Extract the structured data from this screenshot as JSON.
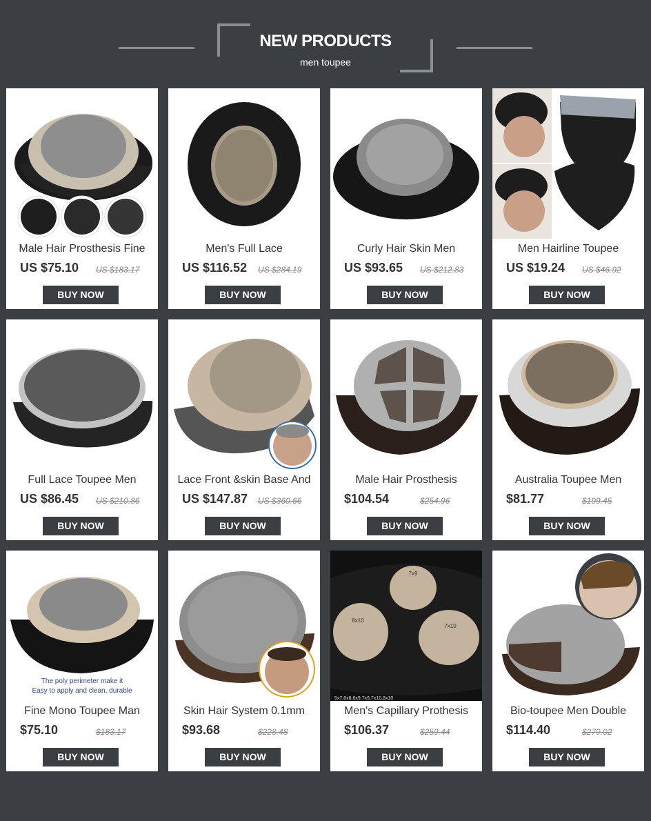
{
  "header": {
    "title": "NEW PRODUCTS",
    "subtitle": "men toupee"
  },
  "colors": {
    "background": "#3b3e42",
    "card": "#ffffff",
    "button": "#3b3e42",
    "button_text": "#ffffff"
  },
  "products": [
    {
      "name": "Male Hair Prosthesis Fine",
      "price": "US $75.10",
      "old_price": "US $183.17",
      "button": "BUY NOW"
    },
    {
      "name": "Men's Full Lace",
      "price": "US $116.52",
      "old_price": "US $284.19",
      "button": "BUY NOW"
    },
    {
      "name": "Curly Hair Skin Men",
      "price": "US $93.65",
      "old_price": "US $212.83",
      "button": "BUY NOW"
    },
    {
      "name": "Men Hairline Toupee",
      "price": "US $19.24",
      "old_price": "US $46.92",
      "button": "BUY NOW"
    },
    {
      "name": "Full Lace Toupee Men",
      "price": "US $86.45",
      "old_price": "US $210.86",
      "button": "BUY NOW"
    },
    {
      "name": "Lace Front &skin Base And",
      "price": "US $147.87",
      "old_price": "US $360.66",
      "button": "BUY NOW"
    },
    {
      "name": "Male Hair Prosthesis",
      "price": "$104.54",
      "old_price": "$254.96",
      "button": "BUY NOW"
    },
    {
      "name": "Australia Toupee Men",
      "price": "$81.77",
      "old_price": "$199.45",
      "button": "BUY NOW"
    },
    {
      "name": "Fine Mono Toupee Man",
      "price": "$75.10",
      "old_price": "$183.17",
      "button": "BUY NOW"
    },
    {
      "name": "Skin Hair System 0.1mm",
      "price": "$93.68",
      "old_price": "$228.48",
      "button": "BUY NOW"
    },
    {
      "name": "Men's Capillary Prothesis",
      "price": "$106.37",
      "old_price": "$259.44",
      "button": "BUY NOW"
    },
    {
      "name": "Bio-toupee Men Double",
      "price": "$114.40",
      "old_price": "$279.02",
      "button": "BUY NOW"
    }
  ],
  "image_texts": {
    "card9_caption_line1": "The poly perimeter make it",
    "card9_caption_line2": "Easy to apply and clean, durable",
    "card11_size_a": "7x9",
    "card11_size_b": "8x10",
    "card11_size_c": "7x10",
    "card11_sizes_line": "5x7,6x8,6x9,7x9,7x10,8x10"
  }
}
